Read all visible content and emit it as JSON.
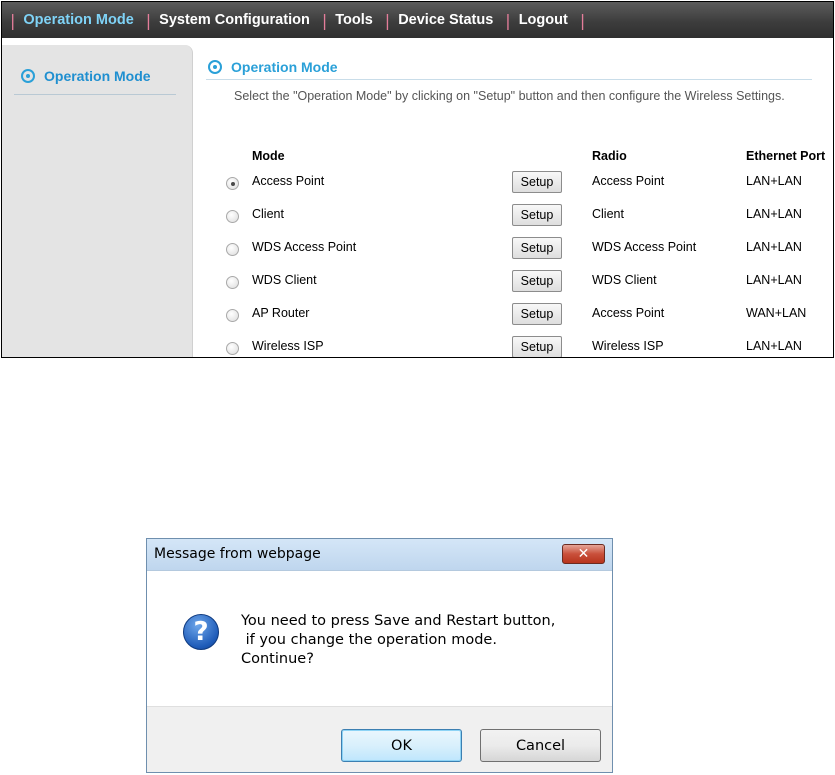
{
  "nav": {
    "separator": "|",
    "items": [
      {
        "label": "Operation Mode",
        "active": true
      },
      {
        "label": "System Configuration",
        "active": false
      },
      {
        "label": "Tools",
        "active": false
      },
      {
        "label": "Device Status",
        "active": false
      },
      {
        "label": "Logout",
        "active": false
      }
    ]
  },
  "sidebar": {
    "items": [
      {
        "label": "Operation Mode",
        "icon": "target-ring-icon"
      }
    ]
  },
  "content": {
    "title": "Operation Mode",
    "instruction": "Select the \"Operation Mode\" by clicking on \"Setup\" button and then configure the Wireless Settings."
  },
  "table": {
    "headers": {
      "mode": "Mode",
      "radio": "Radio",
      "ethernet": "Ethernet Port"
    },
    "setup_label": "Setup",
    "rows": [
      {
        "mode": "Access Point",
        "radio": "Access Point",
        "ethernet": "LAN+LAN",
        "selected": true
      },
      {
        "mode": "Client",
        "radio": "Client",
        "ethernet": "LAN+LAN",
        "selected": false
      },
      {
        "mode": "WDS Access Point",
        "radio": "WDS Access Point",
        "ethernet": "LAN+LAN",
        "selected": false
      },
      {
        "mode": "WDS Client",
        "radio": "WDS Client",
        "ethernet": "LAN+LAN",
        "selected": false
      },
      {
        "mode": "AP Router",
        "radio": "Access Point",
        "ethernet": "WAN+LAN",
        "selected": false
      },
      {
        "mode": "Wireless ISP",
        "radio": "Wireless ISP",
        "ethernet": "LAN+LAN",
        "selected": false
      }
    ]
  },
  "dialog": {
    "title": "Message from webpage",
    "close_glyph": "✕",
    "icon_glyph": "?",
    "message_lines": [
      "You need to press Save and Restart button,",
      " if you change the operation mode.",
      "Continue?"
    ],
    "ok_label": "OK",
    "cancel_label": "Cancel"
  },
  "colors": {
    "nav_active": "#7fd3f7",
    "accent": "#2aa0d8",
    "nav_separator": "#e47d9a",
    "dialog_close": "#c9503b"
  }
}
